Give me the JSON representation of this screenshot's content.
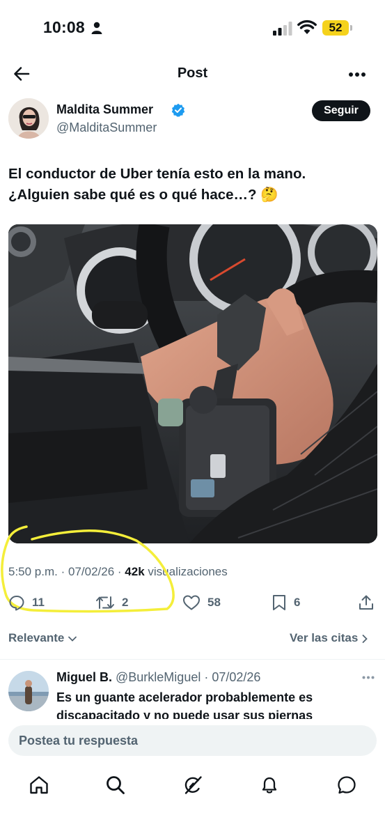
{
  "status_bar": {
    "time": "10:08",
    "battery": "52"
  },
  "header": {
    "title": "Post"
  },
  "author": {
    "name": "Maldita Summer",
    "handle": "@MalditaSummer",
    "follow_label": "Seguir"
  },
  "post": {
    "text_line1": "El conductor de Uber tenía esto en la mano.",
    "text_line2": "¿Alguien sabe qué es o qué hace…? 🤔",
    "media_alt": "Foto de una mano en el volante sosteniendo un dispositivo de fibra de carbono"
  },
  "meta": {
    "time": "5:50 p.m.",
    "date": "07/02/26",
    "views_count": "42k",
    "views_label": "visualizaciones"
  },
  "actions": {
    "replies": "11",
    "reposts": "2",
    "likes": "58",
    "bookmarks": "6"
  },
  "replies_header": {
    "sort_label": "Relevante",
    "quotes_label": "Ver las citas"
  },
  "reply": {
    "name": "Miguel B.",
    "handle": "@BurkleMiguel",
    "date": "07/02/26",
    "text": "Es un guante acelerador probablemente es discapacitado y no puede usar sus piernas"
  },
  "composer": {
    "placeholder": "Postea tu respuesta"
  },
  "colors": {
    "text": "#0f1419",
    "secondary": "#536471",
    "verified": "#1d9bf0",
    "highlight": "#f4ee3a"
  },
  "icons": [
    "person-icon",
    "signal-icon",
    "wifi-icon",
    "back-arrow-icon",
    "more-icon",
    "verified-badge-icon",
    "reply-icon",
    "repost-icon",
    "like-icon",
    "bookmark-icon",
    "share-icon",
    "chevron-down-icon",
    "chevron-right-icon",
    "home-icon",
    "search-icon",
    "grok-icon",
    "notifications-icon",
    "messages-icon"
  ]
}
